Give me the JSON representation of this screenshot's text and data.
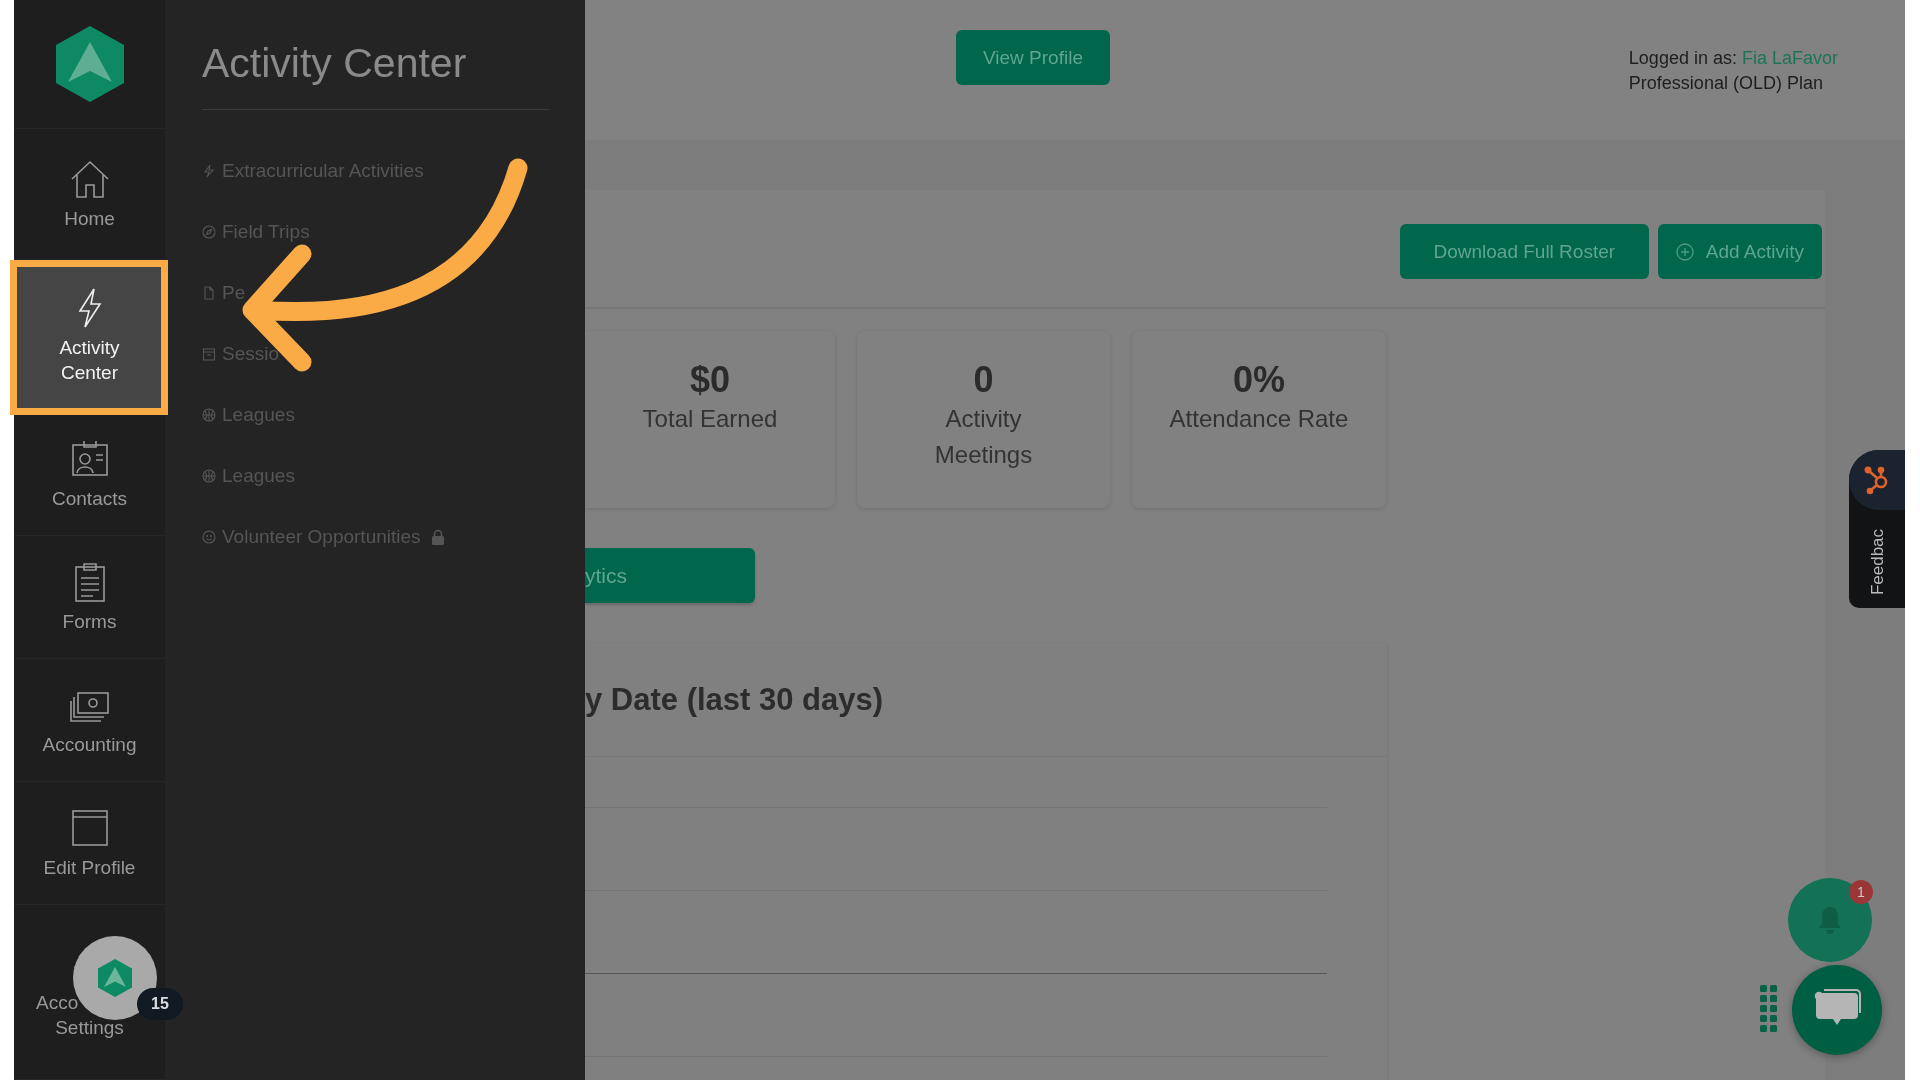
{
  "sidebar": {
    "items": [
      {
        "lines": [
          "Home"
        ],
        "selected": false
      },
      {
        "lines": [
          "Activity",
          "Center"
        ],
        "selected": true
      },
      {
        "lines": [
          "Contacts"
        ],
        "selected": false
      },
      {
        "lines": [
          "Forms"
        ],
        "selected": false
      },
      {
        "lines": [
          "Accounting"
        ],
        "selected": false
      },
      {
        "lines": [
          "Edit Profile"
        ],
        "selected": false
      },
      {
        "lines": [
          "Acco",
          "Settings"
        ],
        "selected": false
      }
    ]
  },
  "flyout": {
    "title": "Activity Center",
    "items": [
      {
        "label": "Extracurricular Activities",
        "locked": false
      },
      {
        "label": "Field Trips",
        "locked": false
      },
      {
        "label": "Pe",
        "locked": false
      },
      {
        "label": "Sessio",
        "locked": false
      },
      {
        "label": "Leagues",
        "locked": false
      },
      {
        "label": "Leagues",
        "locked": false
      },
      {
        "label": "Volunteer Opportunities",
        "locked": true
      }
    ]
  },
  "header": {
    "view_profile": "View Profile",
    "logged_in_label": "Logged in as:",
    "user": "Fia LaFavor",
    "plan": "Professional (OLD) Plan"
  },
  "toolbar": {
    "buttons": [
      "Download Full Roster",
      "Add Activity"
    ]
  },
  "stats": [
    {
      "value": "$0",
      "label": "Total Earned"
    },
    {
      "value": "0",
      "label": "Activity Meetings"
    },
    {
      "value": "0%",
      "label": "Attendance Rate"
    }
  ],
  "analytics_button": "ytics",
  "chart_card": {
    "title": "y Date (last 30 days)"
  },
  "feedback": "Feedbac",
  "notifications": {
    "count": "1"
  },
  "helper_badge": "15"
}
